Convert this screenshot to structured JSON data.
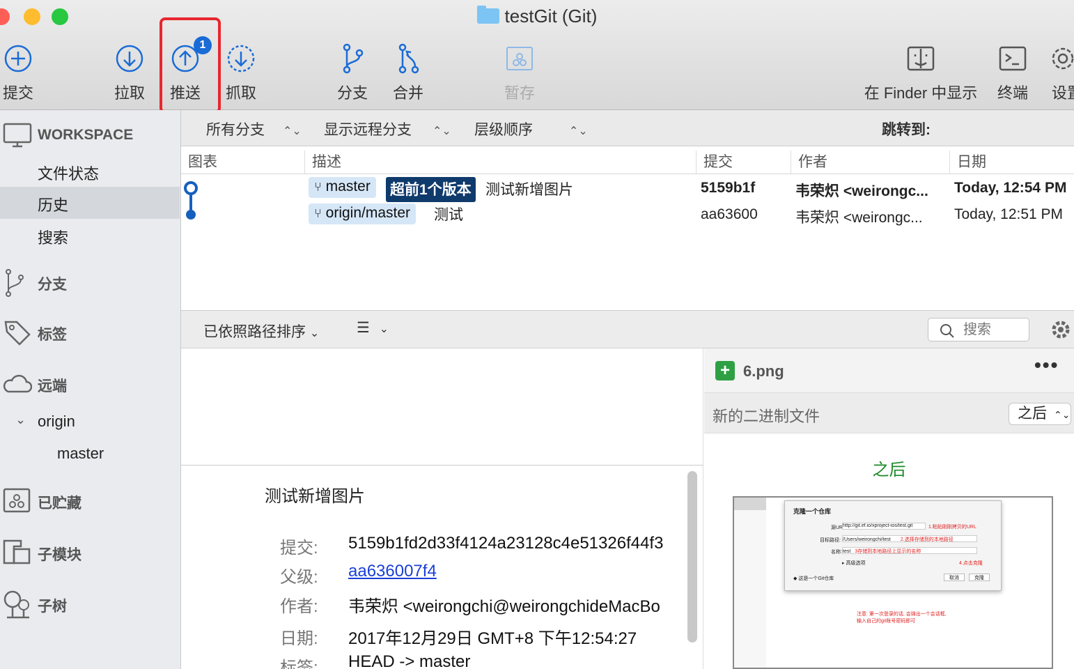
{
  "window": {
    "title": "testGit (Git)"
  },
  "toolbar": {
    "commit": "提交",
    "pull": "拉取",
    "push": "推送",
    "push_badge": "1",
    "fetch": "抓取",
    "branch": "分支",
    "merge": "合并",
    "stash": "暂存",
    "show_in_finder": "在 Finder 中显示",
    "terminal": "终端",
    "settings": "设置"
  },
  "sidebar": {
    "workspace": "WORKSPACE",
    "file_status": "文件状态",
    "history": "历史",
    "search": "搜索",
    "branches": "分支",
    "tags": "标签",
    "remotes": "远端",
    "remote_origin": "origin",
    "remote_branch_master": "master",
    "stashes": "已贮藏",
    "submodules": "子模块",
    "subtrees": "子树"
  },
  "filters": {
    "all_branches": "所有分支",
    "show_remote": "显示远程分支",
    "order": "层级顺序",
    "jump_to": "跳转到:"
  },
  "history": {
    "columns": [
      "图表",
      "描述",
      "提交",
      "作者",
      "日期"
    ],
    "rows": [
      {
        "branch": "master",
        "ahead": "超前1个版本",
        "message": "测试新增图片",
        "hash": "5159b1f",
        "author": "韦荣炽 <weirongc...",
        "date": "Today, 12:54 PM"
      },
      {
        "branch": "origin/master",
        "message": "测试",
        "hash": "aa63600",
        "author": "韦荣炽 <weirongc...",
        "date": "Today, 12:51 PM"
      }
    ]
  },
  "filebar": {
    "sort": "已依照路径排序",
    "search_placeholder": "搜索"
  },
  "detail": {
    "message": "测试新增图片",
    "commit_label": "提交:",
    "commit_value": "5159b1fd2d33f4124a23128c4e51326f44f3",
    "parent_label": "父级:",
    "parent_value": "aa636007f4",
    "author_label": "作者:",
    "author_value": "韦荣炽 <weirongchi@weirongchideMacBo",
    "date_label": "日期:",
    "date_value": "2017年12月29日 GMT+8 下午12:54:27",
    "tags_label": "标签:",
    "tags_value": "HEAD -> master"
  },
  "diff": {
    "filename": "6.png",
    "binary_note": "新的二进制文件",
    "mode": "之后",
    "after_label": "之后"
  },
  "preview": {
    "dialog_title": "克隆一个仓库",
    "url_label": "源URL:",
    "url_value": "http://git.ef.io/xproject-ios/test.git",
    "url_hint": "1.粘贴刚刚拷贝的URL",
    "path_label": "目标路径:",
    "path_value": "/Users/weirongchi/test",
    "path_hint": "2.选择存储到的本地路径",
    "name_label": "名称:",
    "name_value": "test",
    "name_hint": "3存储到本地路径上显示的名称",
    "advanced": "▸ 高级选项",
    "clone_hint": "4.点击克隆",
    "repo_type": "◆ 这是一个Git仓库",
    "cancel": "取消",
    "clone": "克隆",
    "note_line1": "注意: 第一次登录的话, 会弹出一个会话框,",
    "note_line2": "输入自己的git账号密码即可"
  },
  "colors": {
    "accent": "#1a6bd6",
    "highlight_box": "#e8262e",
    "ahead_badge": "#0f3a6c",
    "branch_pill": "#d5e6f7",
    "added_green": "#2ea043"
  }
}
